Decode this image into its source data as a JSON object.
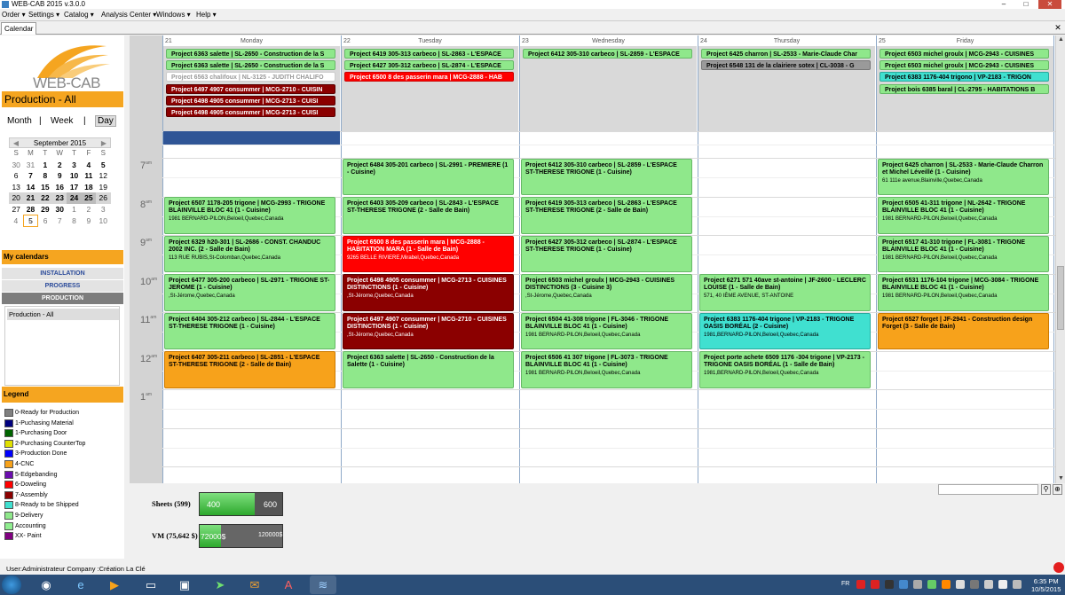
{
  "app": {
    "title": "WEB-CAB 2015 v.3.0.0"
  },
  "menu": [
    "Order",
    "Settings",
    "Catalog",
    "Analysis Center",
    "Windows",
    "Help"
  ],
  "tab": {
    "label": "Calendar"
  },
  "sidebar": {
    "logo_text": "WEB-CAB",
    "production_title": "Production - All",
    "views": {
      "month": "Month",
      "week": "Week",
      "day": "Day",
      "sep": "|"
    },
    "minical": {
      "month_label": "September 2015",
      "prev": "◀",
      "next": "▶",
      "dow": [
        "S",
        "M",
        "T",
        "W",
        "T",
        "F",
        "S"
      ],
      "weeks": [
        [
          "30",
          "31",
          "1",
          "2",
          "3",
          "4",
          "5"
        ],
        [
          "6",
          "7",
          "8",
          "9",
          "10",
          "11",
          "12"
        ],
        [
          "13",
          "14",
          "15",
          "16",
          "17",
          "18",
          "19"
        ],
        [
          "20",
          "21",
          "22",
          "23",
          "24",
          "25",
          "26"
        ],
        [
          "27",
          "28",
          "29",
          "30",
          "1",
          "2",
          "3"
        ],
        [
          "4",
          "5",
          "6",
          "7",
          "8",
          "9",
          "10"
        ]
      ]
    },
    "my_calendars": "My calendars",
    "calendar_buttons": [
      "INSTALLATION",
      "PROGRESS",
      "PRODUCTION"
    ],
    "calendar_list": [
      "Production - All"
    ],
    "legend_title": "Legend",
    "legend": [
      {
        "label": "0-Ready for Production",
        "color": "#808080"
      },
      {
        "label": "1-Puchasing Material",
        "color": "#000080"
      },
      {
        "label": "1-Purchasing Door",
        "color": "#006400"
      },
      {
        "label": "2-Purchasing CounterTop",
        "color": "#e0e000"
      },
      {
        "label": "3-Production Done",
        "color": "#0000ff"
      },
      {
        "label": "4-CNC",
        "color": "#f7a21b"
      },
      {
        "label": "5-Edgebanding",
        "color": "#6a0dad"
      },
      {
        "label": "6-Doweling",
        "color": "#ff0000"
      },
      {
        "label": "7-Assembly",
        "color": "#8b0000"
      },
      {
        "label": "8-Ready to be Shipped",
        "color": "#40e0d0"
      },
      {
        "label": "9-Delivery",
        "color": "#8fe88b"
      },
      {
        "label": "Accounting",
        "color": "#90ee90"
      },
      {
        "label": "XX- Paint",
        "color": "#800080"
      }
    ]
  },
  "calendar": {
    "days": [
      {
        "num": "21",
        "name": "Monday"
      },
      {
        "num": "22",
        "name": "Tuesday"
      },
      {
        "num": "23",
        "name": "Wednesday"
      },
      {
        "num": "24",
        "name": "Thursday"
      },
      {
        "num": "25",
        "name": "Friday"
      }
    ],
    "hours": [
      "7",
      "8",
      "9",
      "10",
      "11",
      "12",
      "1"
    ],
    "hour_suffix": "am",
    "allday": [
      [
        "Project 6363 salette  | SL-2650 - Construction de la S",
        "Project 6363 salette  | SL-2650 - Construction de la S",
        "Project 6563 chalifoux  | NL-3125 - JUDITH CHALIFO",
        "Project 6497 4907 consummer | MCG-2710 - CUISIN",
        "Project 6498 4905 consummer  | MCG-2713 - CUISI",
        "Project 6498 4905 consummer  | MCG-2713 - CUISI"
      ],
      [
        "Project 6419 305-313 carbeco  | SL-2863 - L'ESPACE",
        "Project 6427 305-312  carbeco  | SL-2874 - L'ESPACE",
        "Project 6500 8 des passerin mara  | MCG-2888 - HAB"
      ],
      [
        "Project 6412 305-310 carbeco  | SL-2859 - L'ESPACE"
      ],
      [
        "Project 6425 charron  | SL-2533 - Marie-Claude Char",
        "Project 6548 131 de la clairiere sotex  | CL-3038 - G"
      ],
      [
        "Project 6503 michel groulx  | MCG-2943 - CUISINES",
        "Project 6503 michel groulx  | MCG-2943 - CUISINES",
        "Project 6383 1176-404 trigono  | VP-2183 - TRIGON",
        "Project bois 6385 baral  | CL-2795 - HABITATIONS B"
      ]
    ],
    "events": [
      [
        {
          "t": "Project 6507 1178-205 trigone  | MCG-2993 - TRIGONE BLAINVILLE BLOC 41 (1 - Cuisine)",
          "a": "1981 BERNARD-PILON,Beloeil,Quebec,Canada"
        },
        {
          "t": "Project 6329 h20-301  | SL-2686 - CONST. CHANDUC 2002 INC. (2 - Salle de Bain)",
          "a": "113 RUE RUBIS,St-Colomban,Quebec,Canada"
        },
        {
          "t": "Project 6477  305-200 carbeco  | SL-2971 - TRIGONE  ST-JEROME (1 - Cuisine)",
          "a": ",St-Jérome,Quebec,Canada"
        },
        {
          "t": "Project 6404 305-212 carbeco  | SL-2844 - L'ESPACE ST-THERESE TRIGONE  (1 - Cuisine)",
          "a": ""
        },
        {
          "t": "Project 6407 305-211 carbeco  | SL-2851 - L'ESPACE ST-THERESE TRIGONE  (2 - Salle de Bain)",
          "a": ""
        }
      ],
      [
        {
          "t": "Project 6484 305-201 carbeco  | SL-2991 - PREMIERE  (1 - Cuisine)",
          "a": ""
        },
        {
          "t": "Project 6403 305-209 carbeco  | SL-2843 - L'ESPACE ST-THERESE TRIGONE  (2 - Salle de Bain)",
          "a": ""
        },
        {
          "t": "Project 6500 8 des passerin mara  | MCG-2888 - HABITATION MARA  (1 - Salle de Bain)",
          "a": "9265 BELLE RIVIERE,Mirabel,Quebec,Canada"
        },
        {
          "t": "Project 6498 4905 consummer  | MCG-2713 - CUISINES DISTINCTIONS (1 - Cuisine)",
          "a": ",St-Jérome,Quebec,Canada"
        },
        {
          "t": "Project 6497 4907 consummer | MCG-2710 - CUISINES DISTINCTIONS (1 - Cuisine)",
          "a": ",St-Jérome,Quebec,Canada"
        },
        {
          "t": "Project 6363 salette  | SL-2650 - Construction de la Salette  (1 - Cuisine)",
          "a": ""
        }
      ],
      [
        {
          "t": "Project 6412 305-310 carbeco  | SL-2859 - L'ESPACE ST-THERESE TRIGONE  (1 - Cuisine)",
          "a": ""
        },
        {
          "t": "Project 6419 305-313 carbeco  | SL-2863 - L'ESPACE ST-THERESE TRIGONE  (2 - Salle de Bain)",
          "a": ""
        },
        {
          "t": "Project 6427 305-312  carbeco  | SL-2874 - L'ESPACE ST-THERESE TRIGONE  (1 - Cuisine)",
          "a": ""
        },
        {
          "t": "Project 6503 michel groulx  | MCG-2943 - CUISINES DISTINCTIONS (3 - Cuisine 3)",
          "a": ",St-Jérome,Quebec,Canada"
        },
        {
          "t": "Project 6504 41-308 trigone  | FL-3046 - TRIGONE BLAINVILLE BLOC 41 (1 - Cuisine)",
          "a": "1981 BERNARD-PILON,Beloeil,Quebec,Canada"
        },
        {
          "t": "Project 6506 41 307 trigone  | FL-3073 - TRIGONE BLAINVILLE BLOC 41 (1 - Cuisine)",
          "a": "1981 BERNARD-PILON,Beloeil,Quebec,Canada"
        }
      ],
      [
        {
          "t": "Project 6271 571 40ave st-antoine  | JF-2600 - LECLERC LOUISE (1 - Salle de Bain)",
          "a": "571, 40 IÈME AVENUE, ST-ANTOINE"
        },
        {
          "t": "Project 6383 1176-404 trigone  | VP-2183 - TRIGONE OASIS BORÉAL (2 - Cuisine)",
          "a": "1981,BERNARD-PILON,Beloeil,Quebec,Canada"
        },
        {
          "t": "Project porte achete 6509  1176 -304 trigone  | VP-2173 - TRIGONE OASIS BORÉAL (1 - Salle de Bain)",
          "a": "1981,BERNARD-PILON,Beloeil,Quebec,Canada"
        }
      ],
      [
        {
          "t": "Project 6425 charron  | SL-2533 - Marie-Claude Charron et Michel Léveillé (1 - Cuisine)",
          "a": "61 111e avenue,Blainville,Quebec,Canada"
        },
        {
          "t": "Project 6505 41-311 trigone  | NL-2642 - TRIGONE BLAINVILLE BLOC 41 (1 - Cuisine)",
          "a": "1981 BERNARD-PILON,Beloeil,Quebec,Canada"
        },
        {
          "t": "Project 6517 41-310 trigone  | FL-3081 - TRIGONE BLAINVILLE BLOC 41 (1 - Cuisine)",
          "a": "1981 BERNARD-PILON,Beloeil,Quebec,Canada"
        },
        {
          "t": "Project 6531 1176-104 trigone  | MCG-3084 - TRIGONE BLAINVILLE BLOC 41 (1 - Cuisine)",
          "a": "1981 BERNARD-PILON,Beloeil,Quebec,Canada"
        },
        {
          "t": "Project 6527 forget  | JF-2941 - Construction design Forget  (3 - Salle de Bain)",
          "a": ""
        }
      ]
    ]
  },
  "gauges": {
    "sheets": {
      "label": "Sheets (599)",
      "current": "400",
      "max": "600",
      "fill_fraction": 0.667
    },
    "vm": {
      "label": "VM (75,642 $)",
      "current": "72000$",
      "max": "120000$",
      "fill_fraction": 0.26
    }
  },
  "status": {
    "text": "User:Administrateur  Company :Création La Clé"
  },
  "taskbar": {
    "lang": "FR",
    "time": "6:35 PM",
    "date": "10/5/2015"
  }
}
